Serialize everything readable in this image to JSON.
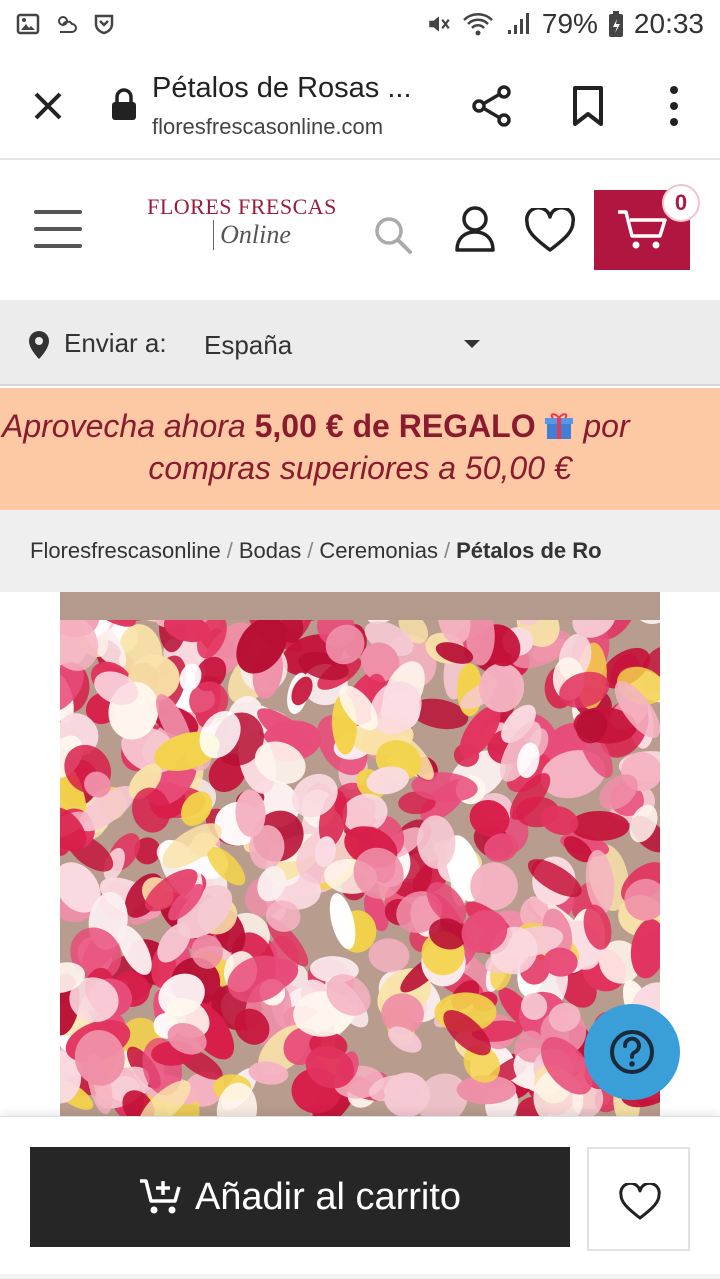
{
  "status_bar": {
    "battery": "79%",
    "time": "20:33"
  },
  "browser": {
    "tab_title": "Pétalos de Rosas ...",
    "url": "floresfrescasonline.com"
  },
  "site": {
    "logo_top": "Flores Frescas",
    "logo_bottom": "Online",
    "cart_count": "0",
    "brand_color": "#b0163f"
  },
  "ship_to": {
    "label": "Enviar a:",
    "value": "España"
  },
  "promo": {
    "prefix": "Aprovecha ahora ",
    "highlight": "5,00 € de REGALO",
    "suffix": " por",
    "line2": "compras superiores a 50,00 €"
  },
  "breadcrumb": {
    "items": [
      "Floresfrescasonline",
      "Bodas",
      "Ceremonias"
    ],
    "current": "Pétalos de Ro"
  },
  "actions": {
    "add_to_cart": "Añadir al carrito"
  }
}
